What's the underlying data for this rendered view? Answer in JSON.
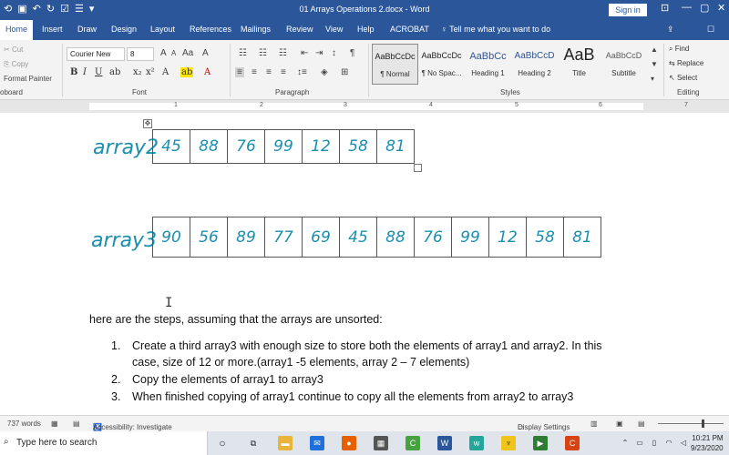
{
  "window": {
    "title": "01 Arrays Operations 2.docx  -  Word",
    "sign_in": "Sign in"
  },
  "tabs": [
    "Home",
    "Insert",
    "Draw",
    "Design",
    "Layout",
    "References",
    "Mailings",
    "Review",
    "View",
    "Help",
    "ACROBAT"
  ],
  "tell_me": "Tell me what you want to do",
  "clipboard": {
    "cut": "Cut",
    "copy": "Copy",
    "format_painter": "Format Painter",
    "label": "oboard"
  },
  "font": {
    "name": "Courier New",
    "size": "8",
    "label": "Font"
  },
  "paragraph": {
    "label": "Paragraph"
  },
  "styles": {
    "label": "Styles",
    "items": [
      {
        "sample": "AaBbCcDc",
        "name": "¶ Normal"
      },
      {
        "sample": "AaBbCcDc",
        "name": "¶ No Spac..."
      },
      {
        "sample": "AaBbCc",
        "name": "Heading 1"
      },
      {
        "sample": "AaBbCcD",
        "name": "Heading 2"
      },
      {
        "sample": "AaB",
        "name": "Title"
      },
      {
        "sample": "AaBbCcD",
        "name": "Subtitle"
      }
    ]
  },
  "editing": {
    "find": "Find",
    "replace": "Replace",
    "select": "Select",
    "label": "Editing"
  },
  "ruler": [
    "1",
    "2",
    "3",
    "4",
    "5",
    "6",
    "7"
  ],
  "document": {
    "array2_label": "array2",
    "array2_values": [
      "45",
      "88",
      "76",
      "99",
      "12",
      "58",
      "81"
    ],
    "array3_label": "array3",
    "array3_values": [
      "90",
      "56",
      "89",
      "77",
      "69",
      "45",
      "88",
      "76",
      "99",
      "12",
      "58",
      "81"
    ],
    "intro": "here are the steps, assuming that the arrays are unsorted:",
    "steps": [
      {
        "num": "1.",
        "lines": [
          "Create a third array3 with enough size to store both the elements of array1 and array2. In this",
          "case, size of 12 or more.(array1 -5 elements, array 2 – 7 elements)"
        ]
      },
      {
        "num": "2.",
        "lines": [
          "Copy the elements of array1 to array3"
        ]
      },
      {
        "num": "3.",
        "lines": [
          "When finished copying of array1 continue to copy all the elements from array2 to array3"
        ]
      }
    ]
  },
  "status": {
    "words": "737 words",
    "accessibility": "Accessibility: Investigate",
    "display_settings": "Display Settings"
  },
  "taskbar": {
    "search_placeholder": "Type here to search",
    "time": "10:21 PM",
    "date": "9/23/2020"
  }
}
